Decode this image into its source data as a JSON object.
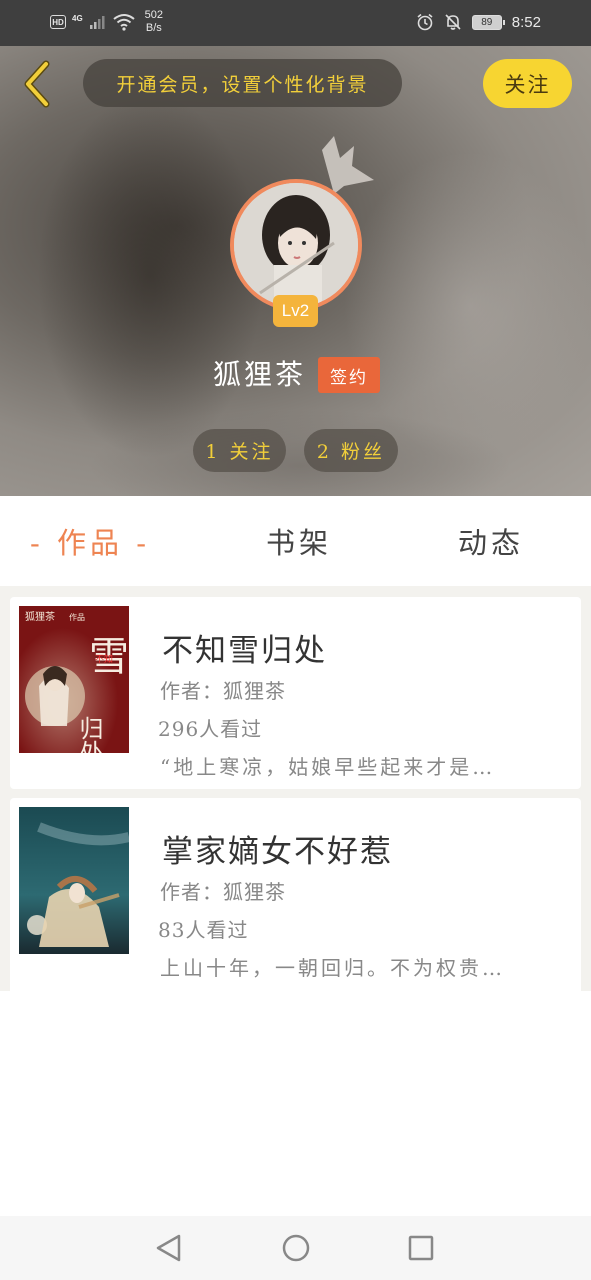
{
  "status_bar": {
    "hd": "HD",
    "network": "4G",
    "speed_value": "502",
    "speed_unit": "B/s",
    "battery": "89",
    "time": "8:52"
  },
  "header": {
    "member_banner": "开通会员，设置个性化背景",
    "follow_label": "关注",
    "level": "Lv2",
    "user_name": "狐狸茶",
    "sign_badge": "签约",
    "following": "1 关注",
    "fans": "2 粉丝"
  },
  "tabs": [
    {
      "label": "- 作品 -",
      "active": true
    },
    {
      "label": "书架",
      "active": false
    },
    {
      "label": "动态",
      "active": false
    }
  ],
  "books": [
    {
      "title": "不知雪归处",
      "author": "作者：狐狸茶",
      "views": "296人看过",
      "desc": "“地上寒凉，姑娘早些起来才是…",
      "cover_author": "狐狸茶",
      "cover_tag": "作品",
      "cover_big": "雪",
      "cover_small": "不知",
      "cover_big2": "归处"
    },
    {
      "title": "掌家嫡女不好惹",
      "author": "作者：狐狸茶",
      "views": "83人看过",
      "desc": "上山十年，一朝回归。不为权贵…"
    }
  ],
  "colors": {
    "accent": "#ee8452",
    "follow_yellow": "#f7d531",
    "banner_text": "#f2cf3a",
    "sign_badge": "#e9673a",
    "level_badge": "#f4b43c"
  },
  "icons": [
    "back-chevron-icon",
    "alarm-icon",
    "mute-bell-icon",
    "nav-back-icon",
    "nav-home-icon",
    "nav-recent-icon"
  ]
}
